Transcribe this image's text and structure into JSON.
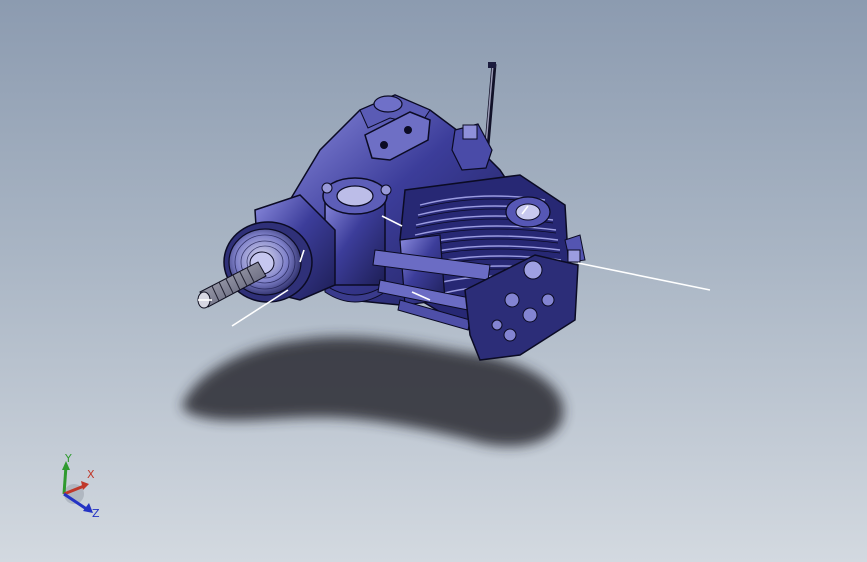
{
  "viewport": {
    "background_top": "#8c9bb0",
    "background_bottom": "#d3d9e0"
  },
  "model": {
    "body_color": "#2e2f7a",
    "highlight_color": "#8d8de0",
    "outline_color": "#0b0b24",
    "shadow_color": "#2a2a33"
  },
  "triad": {
    "x_label": "X",
    "y_label": "Y",
    "z_label": "Z",
    "x_color": "#c0392b",
    "y_color": "#2f9a2f",
    "z_color": "#2433c4"
  }
}
